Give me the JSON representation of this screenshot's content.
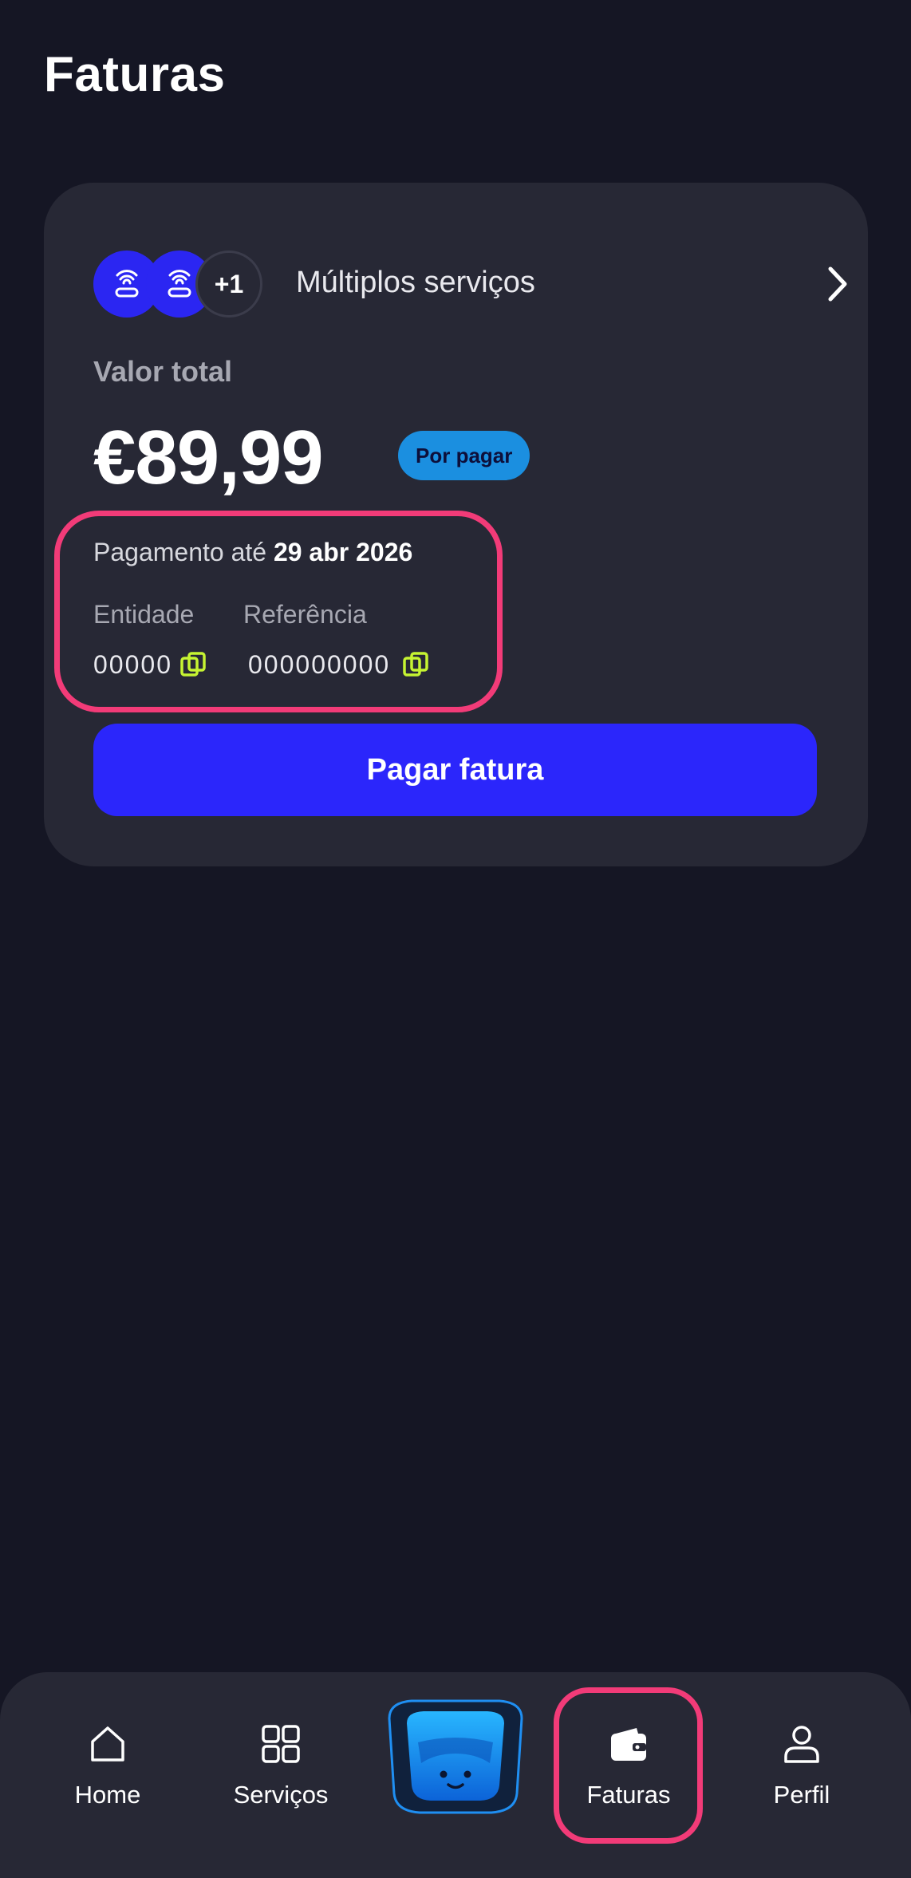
{
  "header": {
    "title": "Faturas"
  },
  "invoice": {
    "services_label": "Múltiplos serviços",
    "extra_services_count": "+1",
    "total_label": "Valor total",
    "amount": "€89,99",
    "status": "Por pagar",
    "due_prefix": "Pagamento até",
    "due_date": "29 abr 2026",
    "entity_label": "Entidade",
    "entity_value": "00000",
    "reference_label": "Referência",
    "reference_value": "000000000",
    "pay_button": "Pagar fatura"
  },
  "nav": {
    "items": [
      {
        "label": "Home",
        "icon": "home-icon"
      },
      {
        "label": "Serviços",
        "icon": "grid-icon"
      },
      {
        "label": "",
        "icon": "assistant-avatar"
      },
      {
        "label": "Faturas",
        "icon": "wallet-icon",
        "active": true
      },
      {
        "label": "Perfil",
        "icon": "user-icon"
      }
    ]
  },
  "colors": {
    "background": "#151624",
    "card": "#272835",
    "accent_blue": "#2b26fb",
    "badge_blue": "#1b8fe0",
    "copy_icon": "#c6f432",
    "highlight": "#f23b78"
  }
}
